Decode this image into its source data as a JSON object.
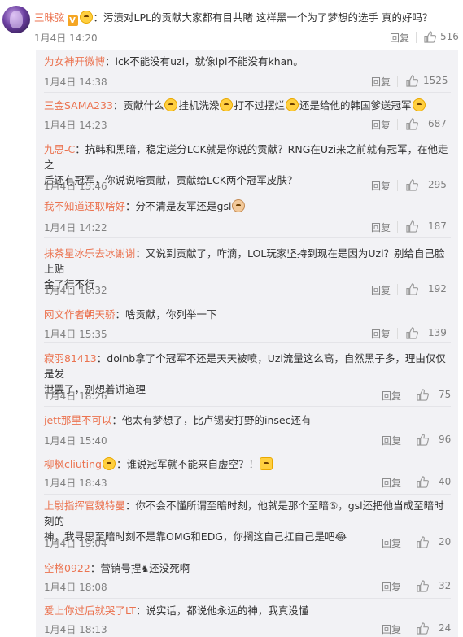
{
  "top_comment": {
    "username": "三昧弦",
    "badge": "V",
    "separator": "：",
    "text": "污渍对LPL的贡献大家都有目共睹 这样黑一个为了梦想的选手 真的好吗？",
    "time": "1月4日 14:20",
    "reply_label": "回复",
    "likes": "516"
  },
  "replies": [
    {
      "user": "为女神开微博",
      "text": "lck不能没有uzi，就像lpl不能没有khan。",
      "text2": "",
      "time": "1月4日 14:38",
      "reply_label": "回复",
      "likes": "1525"
    },
    {
      "user": "三金SAMA233",
      "text": "贡献什么",
      "seg2": "挂机洗澡",
      "seg3": "打不过摆烂",
      "seg4": "还是给他的韩国爹送冠军",
      "time": "1月4日 14:23",
      "reply_label": "回复",
      "likes": "687"
    },
    {
      "user": "九思-C",
      "text": "抗韩和黑暗，稳定送分LCK就是你说的贡献？RNG在Uzi来之前就有冠军，在他走之",
      "text2": "后还有冠军，你说说啥贡献，贡献给LCK两个冠军皮肤？",
      "time": "1月4日 15:46",
      "reply_label": "回复",
      "likes": "295"
    },
    {
      "user": "我不知道还取啥好",
      "text": "分不清是友军还是gsl",
      "text2": "",
      "time": "1月4日 14:22",
      "reply_label": "回复",
      "likes": "187"
    },
    {
      "user": "抹茶星冰乐去冰谢谢",
      "text": "又说到贡献了，咋滴，LOL玩家坚持到现在是因为Uzi？别给自己脸上贴",
      "text2": "金了行不行",
      "time": "1月4日 16:32",
      "reply_label": "回复",
      "likes": "192"
    },
    {
      "user": "网文作者朝天骄",
      "text": "啥贡献，你列举一下",
      "text2": "",
      "time": "1月4日 15:35",
      "reply_label": "回复",
      "likes": "139"
    },
    {
      "user": "寂羽81413",
      "text": "doinb拿了个冠军不还是天天被喷，Uzi流量这么高，自然黑子多，理由仅仅是发",
      "text2": "泄罢了，别想着讲道理",
      "time": "1月4日 18:26",
      "reply_label": "回复",
      "likes": "75"
    },
    {
      "user": "jett那里不可以",
      "text": "他太有梦想了，比卢锡安打野的insec还有",
      "text2": "",
      "time": "1月4日 15:40",
      "reply_label": "回复",
      "likes": "96"
    },
    {
      "user": "柳枫cliuting",
      "text": "谁说冠军就不能来自虚空？！",
      "text2": "",
      "time": "1月4日 18:43",
      "reply_label": "回复",
      "likes": "40"
    },
    {
      "user": "上尉指挥官魏特曼",
      "text": "你不会不懂所谓至暗时刻，他就是那个至暗⑤，gsl还把他当成至暗时刻的",
      "text2": "神，我寻思至暗时刻不是靠OMG和EDG，你搁这自己扛自己是吧😂",
      "time": "1月4日 19:04",
      "reply_label": "回复",
      "likes": "20"
    },
    {
      "user": "空格0922",
      "text": "营销号捏",
      "seg2": "还没死啊",
      "text2": "",
      "time": "1月4日 18:08",
      "reply_label": "回复",
      "likes": "32"
    },
    {
      "user": "爱上你过后就哭了LT",
      "text": "说实话，都说他永远的神，我真没懂",
      "text2": "",
      "time": "1月4日 18:13",
      "reply_label": "回复",
      "likes": "24"
    }
  ]
}
